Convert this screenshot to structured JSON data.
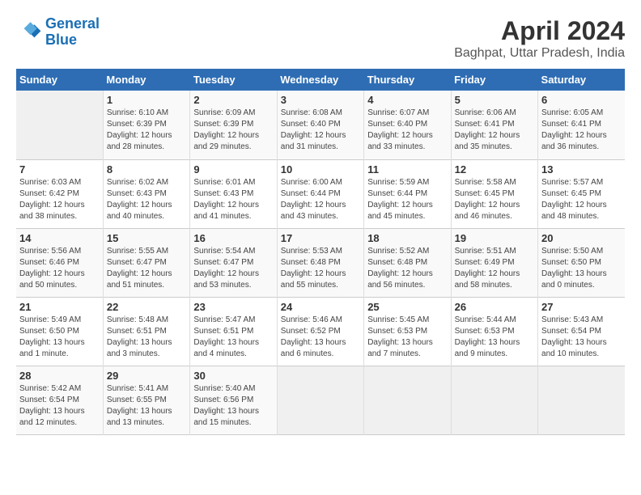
{
  "header": {
    "logo_line1": "General",
    "logo_line2": "Blue",
    "title": "April 2024",
    "subtitle": "Baghpat, Uttar Pradesh, India"
  },
  "columns": [
    "Sunday",
    "Monday",
    "Tuesday",
    "Wednesday",
    "Thursday",
    "Friday",
    "Saturday"
  ],
  "weeks": [
    [
      {
        "day": "",
        "detail": ""
      },
      {
        "day": "1",
        "detail": "Sunrise: 6:10 AM\nSunset: 6:39 PM\nDaylight: 12 hours\nand 28 minutes."
      },
      {
        "day": "2",
        "detail": "Sunrise: 6:09 AM\nSunset: 6:39 PM\nDaylight: 12 hours\nand 29 minutes."
      },
      {
        "day": "3",
        "detail": "Sunrise: 6:08 AM\nSunset: 6:40 PM\nDaylight: 12 hours\nand 31 minutes."
      },
      {
        "day": "4",
        "detail": "Sunrise: 6:07 AM\nSunset: 6:40 PM\nDaylight: 12 hours\nand 33 minutes."
      },
      {
        "day": "5",
        "detail": "Sunrise: 6:06 AM\nSunset: 6:41 PM\nDaylight: 12 hours\nand 35 minutes."
      },
      {
        "day": "6",
        "detail": "Sunrise: 6:05 AM\nSunset: 6:41 PM\nDaylight: 12 hours\nand 36 minutes."
      }
    ],
    [
      {
        "day": "7",
        "detail": "Sunrise: 6:03 AM\nSunset: 6:42 PM\nDaylight: 12 hours\nand 38 minutes."
      },
      {
        "day": "8",
        "detail": "Sunrise: 6:02 AM\nSunset: 6:43 PM\nDaylight: 12 hours\nand 40 minutes."
      },
      {
        "day": "9",
        "detail": "Sunrise: 6:01 AM\nSunset: 6:43 PM\nDaylight: 12 hours\nand 41 minutes."
      },
      {
        "day": "10",
        "detail": "Sunrise: 6:00 AM\nSunset: 6:44 PM\nDaylight: 12 hours\nand 43 minutes."
      },
      {
        "day": "11",
        "detail": "Sunrise: 5:59 AM\nSunset: 6:44 PM\nDaylight: 12 hours\nand 45 minutes."
      },
      {
        "day": "12",
        "detail": "Sunrise: 5:58 AM\nSunset: 6:45 PM\nDaylight: 12 hours\nand 46 minutes."
      },
      {
        "day": "13",
        "detail": "Sunrise: 5:57 AM\nSunset: 6:45 PM\nDaylight: 12 hours\nand 48 minutes."
      }
    ],
    [
      {
        "day": "14",
        "detail": "Sunrise: 5:56 AM\nSunset: 6:46 PM\nDaylight: 12 hours\nand 50 minutes."
      },
      {
        "day": "15",
        "detail": "Sunrise: 5:55 AM\nSunset: 6:47 PM\nDaylight: 12 hours\nand 51 minutes."
      },
      {
        "day": "16",
        "detail": "Sunrise: 5:54 AM\nSunset: 6:47 PM\nDaylight: 12 hours\nand 53 minutes."
      },
      {
        "day": "17",
        "detail": "Sunrise: 5:53 AM\nSunset: 6:48 PM\nDaylight: 12 hours\nand 55 minutes."
      },
      {
        "day": "18",
        "detail": "Sunrise: 5:52 AM\nSunset: 6:48 PM\nDaylight: 12 hours\nand 56 minutes."
      },
      {
        "day": "19",
        "detail": "Sunrise: 5:51 AM\nSunset: 6:49 PM\nDaylight: 12 hours\nand 58 minutes."
      },
      {
        "day": "20",
        "detail": "Sunrise: 5:50 AM\nSunset: 6:50 PM\nDaylight: 13 hours\nand 0 minutes."
      }
    ],
    [
      {
        "day": "21",
        "detail": "Sunrise: 5:49 AM\nSunset: 6:50 PM\nDaylight: 13 hours\nand 1 minute."
      },
      {
        "day": "22",
        "detail": "Sunrise: 5:48 AM\nSunset: 6:51 PM\nDaylight: 13 hours\nand 3 minutes."
      },
      {
        "day": "23",
        "detail": "Sunrise: 5:47 AM\nSunset: 6:51 PM\nDaylight: 13 hours\nand 4 minutes."
      },
      {
        "day": "24",
        "detail": "Sunrise: 5:46 AM\nSunset: 6:52 PM\nDaylight: 13 hours\nand 6 minutes."
      },
      {
        "day": "25",
        "detail": "Sunrise: 5:45 AM\nSunset: 6:53 PM\nDaylight: 13 hours\nand 7 minutes."
      },
      {
        "day": "26",
        "detail": "Sunrise: 5:44 AM\nSunset: 6:53 PM\nDaylight: 13 hours\nand 9 minutes."
      },
      {
        "day": "27",
        "detail": "Sunrise: 5:43 AM\nSunset: 6:54 PM\nDaylight: 13 hours\nand 10 minutes."
      }
    ],
    [
      {
        "day": "28",
        "detail": "Sunrise: 5:42 AM\nSunset: 6:54 PM\nDaylight: 13 hours\nand 12 minutes."
      },
      {
        "day": "29",
        "detail": "Sunrise: 5:41 AM\nSunset: 6:55 PM\nDaylight: 13 hours\nand 13 minutes."
      },
      {
        "day": "30",
        "detail": "Sunrise: 5:40 AM\nSunset: 6:56 PM\nDaylight: 13 hours\nand 15 minutes."
      },
      {
        "day": "",
        "detail": ""
      },
      {
        "day": "",
        "detail": ""
      },
      {
        "day": "",
        "detail": ""
      },
      {
        "day": "",
        "detail": ""
      }
    ]
  ]
}
